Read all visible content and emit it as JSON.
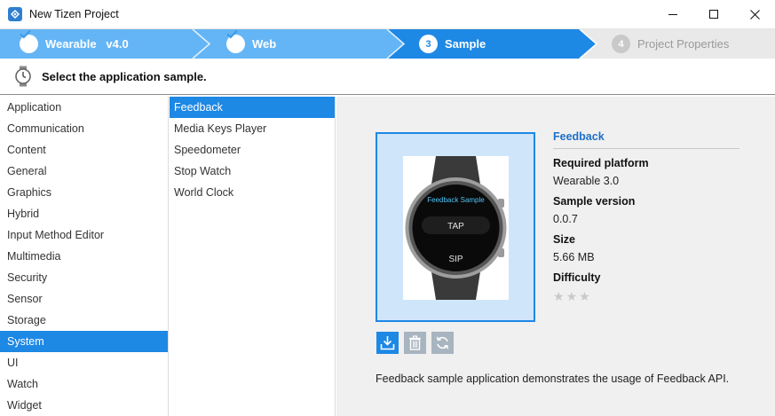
{
  "window": {
    "title": "New Tizen Project"
  },
  "steps": [
    {
      "label": "Wearable   v4.0",
      "state": "done"
    },
    {
      "label": "Web",
      "state": "done"
    },
    {
      "number": "3",
      "label": "Sample",
      "state": "current"
    },
    {
      "number": "4",
      "label": "Project Properties",
      "state": "pending"
    }
  ],
  "header": {
    "text": "Select the application sample."
  },
  "categories": [
    "Application",
    "Communication",
    "Content",
    "General",
    "Graphics",
    "Hybrid",
    "Input Method Editor",
    "Multimedia",
    "Security",
    "Sensor",
    "Storage",
    "System",
    "UI",
    "Watch",
    "Widget"
  ],
  "selected_category": "System",
  "samples": [
    "Feedback",
    "Media Keys Player",
    "Speedometer",
    "Stop Watch",
    "World Clock"
  ],
  "selected_sample": "Feedback",
  "preview": {
    "title": "Feedback Sample",
    "tap": "TAP",
    "sip": "SIP"
  },
  "details": {
    "name": "Feedback",
    "platform_label": "Required platform",
    "platform_value": "Wearable 3.0",
    "version_label": "Sample version",
    "version_value": "0.0.7",
    "size_label": "Size",
    "size_value": "5.66 MB",
    "difficulty_label": "Difficulty",
    "difficulty_stars": 0
  },
  "description": "Feedback sample application demonstrates the usage of Feedback API.",
  "colors": {
    "accent": "#1e88e5",
    "step_done": "#64b5f6",
    "step_current": "#1e88e5",
    "step_pending": "#e9e9e9"
  }
}
